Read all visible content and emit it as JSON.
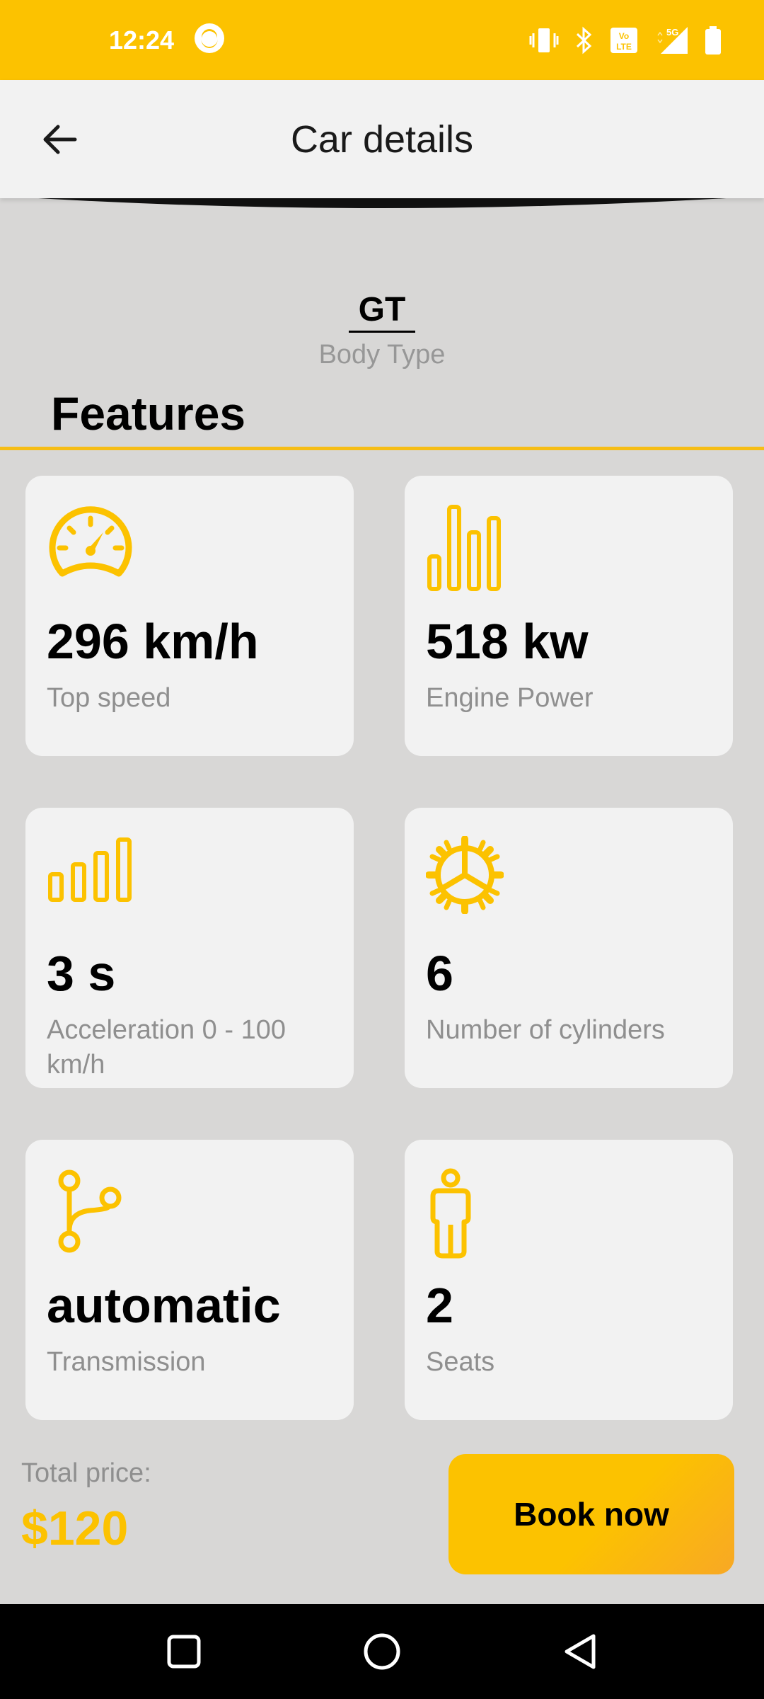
{
  "status_bar": {
    "time": "12:24"
  },
  "app_bar": {
    "title": "Car details"
  },
  "body_type": {
    "value": "GT",
    "label": "Body Type"
  },
  "features": {
    "title": "Features",
    "cards": [
      {
        "icon": "speedometer-icon",
        "value": "296 km/h",
        "label": "Top speed"
      },
      {
        "icon": "bar-chart-icon",
        "value": "518 kw",
        "label": "Engine Power"
      },
      {
        "icon": "signal-bars-icon",
        "value": "3 s",
        "label": "Acceleration 0 - 100 km/h"
      },
      {
        "icon": "gear-icon",
        "value": "6",
        "label": "Number of cylinders"
      },
      {
        "icon": "branch-icon",
        "value": "automatic",
        "label": "Transmission"
      },
      {
        "icon": "person-icon",
        "value": "2",
        "label": "Seats"
      }
    ]
  },
  "footer": {
    "total_label": "Total price:",
    "total_value": "$120",
    "book_label": "Book now"
  },
  "colors": {
    "accent": "#fcc200",
    "background": "#d8d7d6",
    "card": "#f2f2f2"
  }
}
